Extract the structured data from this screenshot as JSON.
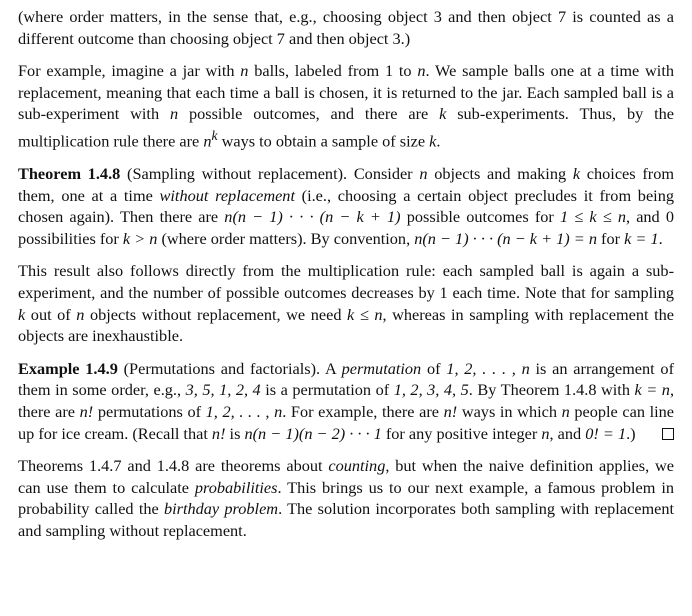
{
  "paragraphs": {
    "p0": "(where order matters, in the sense that, e.g., choosing object 3 and then object 7 is counted as a different outcome than choosing object 7 and then object 3.)",
    "p1a": "For example, imagine a jar with ",
    "p1n1": "n",
    "p1b": " balls, labeled from 1 to ",
    "p1n2": "n",
    "p1c": ". We sample balls one at a time with replacement, meaning that each time a ball is chosen, it is returned to the jar. Each sampled ball is a sub-experiment with ",
    "p1n3": "n",
    "p1d": " possible outcomes, and there are ",
    "p1k1": "k",
    "p1e": " sub-experiments. Thus, by the multiplication rule there are ",
    "p1nk": "n",
    "p1sup": "k",
    "p1f": " ways to obtain a sample of size ",
    "p1k2": "k",
    "p1g": ".",
    "thm_label": "Theorem 1.4.8",
    "thm_title": " (Sampling without replacement).",
    "thm_a": " Consider ",
    "thm_n1": "n",
    "thm_b": " objects and making ",
    "thm_k1": "k",
    "thm_c": " choices from them, one at a time ",
    "thm_without": "without replacement",
    "thm_d": " (i.e., choosing a certain object precludes it from being chosen again). Then there are ",
    "thm_formula1": "n(n − 1) · · · (n − k + 1)",
    "thm_e": " possible outcomes for ",
    "thm_range": "1 ≤ k ≤ n",
    "thm_f": ", and 0 possibilities for ",
    "thm_kgn": "k > n",
    "thm_g": " (where order matters). By convention, ",
    "thm_formula2": "n(n − 1) · · · (n − k + 1) = n",
    "thm_h": " for ",
    "thm_k1eq": "k = 1",
    "thm_i": ".",
    "p3a": "This result also follows directly from the multiplication rule: each sampled ball is again a sub-experiment, and the number of possible outcomes decreases by 1 each time. Note that for sampling ",
    "p3k": "k",
    "p3b": " out of ",
    "p3n": "n",
    "p3c": " objects without replacement, we need ",
    "p3kn": "k ≤ n",
    "p3d": ", whereas in sampling with replacement the objects are inexhaustible.",
    "ex_label": "Example 1.4.9",
    "ex_title": " (Permutations and factorials).",
    "ex_a": " A ",
    "ex_perm": "permutation",
    "ex_b": " of ",
    "ex_seq1": "1, 2, . . . , n",
    "ex_c": " is an arrangement of them in some order, e.g., ",
    "ex_seq2": "3, 5, 1, 2, 4",
    "ex_d": " is a permutation of ",
    "ex_seq3": "1, 2, 3, 4, 5",
    "ex_e": ". By Theorem 1.4.8 with ",
    "ex_keqn": "k = n",
    "ex_f": ", there are ",
    "ex_nfact1": "n!",
    "ex_g": " permutations of ",
    "ex_seq4": "1, 2, . . . , n",
    "ex_h": ". For example, there are ",
    "ex_nfact2": "n!",
    "ex_i": " ways in which ",
    "ex_n": "n",
    "ex_j": " people can line up for ice cream. (Recall that ",
    "ex_nfact3": "n!",
    "ex_k": " is ",
    "ex_formula": "n(n − 1)(n − 2) · · · 1",
    "ex_l": " for any positive integer ",
    "ex_n2": "n",
    "ex_m": ", and ",
    "ex_zero": "0! = 1",
    "ex_o": ".)",
    "p5a": "Theorems 1.4.7 and 1.4.8 are theorems about ",
    "p5counting": "counting",
    "p5b": ", but when the naive definition applies, we can use them to calculate ",
    "p5prob": "probabilities",
    "p5c": ". This brings us to our next example, a famous problem in probability called the ",
    "p5bday": "birthday problem",
    "p5d": ". The solution incorporates both sampling with replacement and sampling without replacement."
  }
}
